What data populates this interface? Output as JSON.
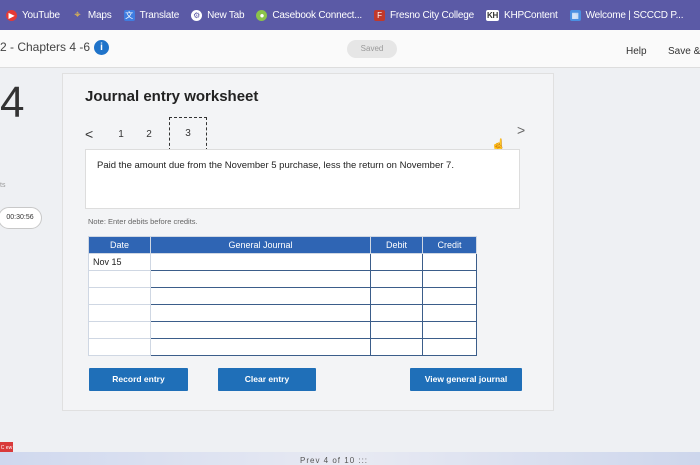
{
  "bookmarks": [
    {
      "label": "YouTube",
      "icon": "youtube-icon",
      "glyph": "▶"
    },
    {
      "label": "Maps",
      "icon": "maps-icon",
      "glyph": "⌖"
    },
    {
      "label": "Translate",
      "icon": "translate-icon",
      "glyph": "文"
    },
    {
      "label": "New Tab",
      "icon": "new-tab-icon",
      "glyph": "⚙"
    },
    {
      "label": "Casebook Connect...",
      "icon": "casebook-icon",
      "glyph": "●"
    },
    {
      "label": "Fresno City College",
      "icon": "fresno-icon",
      "glyph": "F"
    },
    {
      "label": "KHPContent",
      "icon": "khp-icon",
      "glyph": "KH"
    },
    {
      "label": "Welcome | SCCCD P...",
      "icon": "welcome-icon",
      "glyph": "▦"
    }
  ],
  "header": {
    "chapter": "2 - Chapters 4 -6",
    "saved": "Saved",
    "help": "Help",
    "save_exit": "Save &"
  },
  "left_rail": {
    "question_number": "4",
    "points_fragment": "ts",
    "timer": "00:30:56",
    "mini_icon_text": "C ew"
  },
  "worksheet": {
    "title": "Journal entry worksheet",
    "pages": [
      "1",
      "2",
      "3"
    ],
    "active_page": "3",
    "prev_glyph": "<",
    "next_glyph": ">",
    "problem_text": "Paid the amount due from the November 5 purchase, less the return on November 7.",
    "note": "Note: Enter debits before credits.",
    "table": {
      "headers": {
        "date": "Date",
        "general_journal": "General Journal",
        "debit": "Debit",
        "credit": "Credit"
      },
      "rows": [
        {
          "date": "Nov 15",
          "account": "",
          "debit": "",
          "credit": ""
        },
        {
          "date": "",
          "account": "",
          "debit": "",
          "credit": ""
        },
        {
          "date": "",
          "account": "",
          "debit": "",
          "credit": ""
        },
        {
          "date": "",
          "account": "",
          "debit": "",
          "credit": ""
        },
        {
          "date": "",
          "account": "",
          "debit": "",
          "credit": ""
        },
        {
          "date": "",
          "account": "",
          "debit": "",
          "credit": ""
        }
      ]
    },
    "buttons": {
      "record": "Record entry",
      "clear": "Clear entry",
      "view": "View general journal"
    }
  },
  "footer": {
    "fragment": "Prev   4  of  10   :::"
  },
  "colors": {
    "bookmark_bar": "#5b5aa6",
    "accent_blue": "#1f6fb8",
    "table_header": "#2f65b4"
  }
}
